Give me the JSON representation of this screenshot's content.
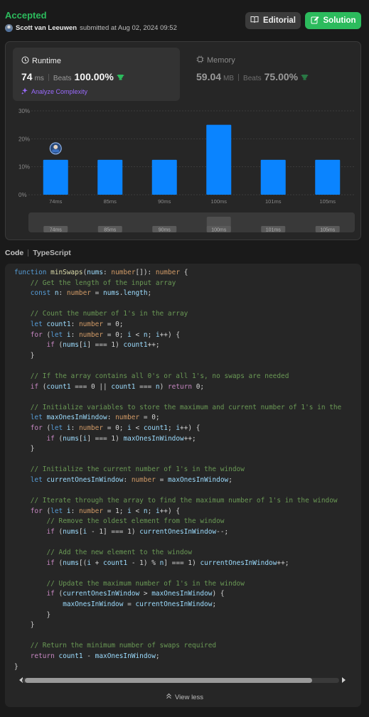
{
  "header": {
    "status": "Accepted",
    "username": "Scott van Leeuwen",
    "submitted_text": "submitted at Aug 02, 2024 09:52",
    "editorial_label": "Editorial",
    "solution_label": "Solution"
  },
  "runtime": {
    "title": "Runtime",
    "value": "74",
    "unit": "ms",
    "beats_label": "Beats",
    "beats_value": "100.00%",
    "analyze_label": "Analyze Complexity"
  },
  "memory": {
    "title": "Memory",
    "value": "59.04",
    "unit": "MB",
    "beats_label": "Beats",
    "beats_value": "75.00%"
  },
  "chart_data": {
    "type": "bar",
    "categories": [
      "74ms",
      "85ms",
      "90ms",
      "100ms",
      "101ms",
      "105ms"
    ],
    "values": [
      12.5,
      12.5,
      12.5,
      25,
      12.5,
      12.5
    ],
    "y_ticks": [
      "30%",
      "20%",
      "10%",
      "0%"
    ],
    "ylim": [
      0,
      30
    ],
    "highlight_index": 0,
    "bar_color": "#0a84ff",
    "grid": true
  },
  "scrubber": {
    "labels": [
      "74ms",
      "85ms",
      "90ms",
      "100ms",
      "101ms",
      "105ms"
    ],
    "selected_index": 3
  },
  "code_section": {
    "label": "Code",
    "language": "TypeScript",
    "lines": [
      [
        [
          "kw",
          "function "
        ],
        [
          "fn",
          "minSwaps"
        ],
        [
          "nm",
          "("
        ],
        [
          "va",
          "nums"
        ],
        [
          "nm",
          ": "
        ],
        [
          "ty",
          "number"
        ],
        [
          "nm",
          "[]): "
        ],
        [
          "ty",
          "number"
        ],
        [
          "nm",
          " {"
        ]
      ],
      [
        [
          "nm",
          "    "
        ],
        [
          "cm",
          "// Get the length of the input array"
        ]
      ],
      [
        [
          "nm",
          "    "
        ],
        [
          "kw",
          "const "
        ],
        [
          "va",
          "n"
        ],
        [
          "nm",
          ": "
        ],
        [
          "ty",
          "number"
        ],
        [
          "nm",
          " = "
        ],
        [
          "va",
          "nums"
        ],
        [
          "nm",
          "."
        ],
        [
          "va",
          "length"
        ],
        [
          "nm",
          ";"
        ]
      ],
      [
        [
          "nm",
          ""
        ]
      ],
      [
        [
          "nm",
          "    "
        ],
        [
          "cm",
          "// Count the number of 1's in the array"
        ]
      ],
      [
        [
          "nm",
          "    "
        ],
        [
          "kw",
          "let "
        ],
        [
          "va",
          "count1"
        ],
        [
          "nm",
          ": "
        ],
        [
          "ty",
          "number"
        ],
        [
          "nm",
          " = 0;"
        ]
      ],
      [
        [
          "nm",
          "    "
        ],
        [
          "kw2",
          "for "
        ],
        [
          "nm",
          "("
        ],
        [
          "kw",
          "let "
        ],
        [
          "va",
          "i"
        ],
        [
          "nm",
          ": "
        ],
        [
          "ty",
          "number"
        ],
        [
          "nm",
          " = 0; "
        ],
        [
          "va",
          "i"
        ],
        [
          "nm",
          " < "
        ],
        [
          "va",
          "n"
        ],
        [
          "nm",
          "; "
        ],
        [
          "va",
          "i"
        ],
        [
          "nm",
          "++) {"
        ]
      ],
      [
        [
          "nm",
          "        "
        ],
        [
          "kw2",
          "if "
        ],
        [
          "nm",
          "("
        ],
        [
          "va",
          "nums"
        ],
        [
          "nm",
          "["
        ],
        [
          "va",
          "i"
        ],
        [
          "nm",
          "] === 1) "
        ],
        [
          "va",
          "count1"
        ],
        [
          "nm",
          "++;"
        ]
      ],
      [
        [
          "nm",
          "    }"
        ]
      ],
      [
        [
          "nm",
          ""
        ]
      ],
      [
        [
          "nm",
          "    "
        ],
        [
          "cm",
          "// If the array contains all 0's or all 1's, no swaps are needed"
        ]
      ],
      [
        [
          "nm",
          "    "
        ],
        [
          "kw2",
          "if "
        ],
        [
          "nm",
          "("
        ],
        [
          "va",
          "count1"
        ],
        [
          "nm",
          " === 0 || "
        ],
        [
          "va",
          "count1"
        ],
        [
          "nm",
          " === "
        ],
        [
          "va",
          "n"
        ],
        [
          "nm",
          ") "
        ],
        [
          "kw2",
          "return "
        ],
        [
          "nm",
          "0;"
        ]
      ],
      [
        [
          "nm",
          ""
        ]
      ],
      [
        [
          "nm",
          "    "
        ],
        [
          "cm",
          "// Initialize variables to store the maximum and current number of 1's in the"
        ]
      ],
      [
        [
          "nm",
          "    "
        ],
        [
          "kw",
          "let "
        ],
        [
          "va",
          "maxOnesInWindow"
        ],
        [
          "nm",
          ": "
        ],
        [
          "ty",
          "number"
        ],
        [
          "nm",
          " = 0;"
        ]
      ],
      [
        [
          "nm",
          "    "
        ],
        [
          "kw2",
          "for "
        ],
        [
          "nm",
          "("
        ],
        [
          "kw",
          "let "
        ],
        [
          "va",
          "i"
        ],
        [
          "nm",
          ": "
        ],
        [
          "ty",
          "number"
        ],
        [
          "nm",
          " = 0; "
        ],
        [
          "va",
          "i"
        ],
        [
          "nm",
          " < "
        ],
        [
          "va",
          "count1"
        ],
        [
          "nm",
          "; "
        ],
        [
          "va",
          "i"
        ],
        [
          "nm",
          "++) {"
        ]
      ],
      [
        [
          "nm",
          "        "
        ],
        [
          "kw2",
          "if "
        ],
        [
          "nm",
          "("
        ],
        [
          "va",
          "nums"
        ],
        [
          "nm",
          "["
        ],
        [
          "va",
          "i"
        ],
        [
          "nm",
          "] === 1) "
        ],
        [
          "va",
          "maxOnesInWindow"
        ],
        [
          "nm",
          "++;"
        ]
      ],
      [
        [
          "nm",
          "    }"
        ]
      ],
      [
        [
          "nm",
          ""
        ]
      ],
      [
        [
          "nm",
          "    "
        ],
        [
          "cm",
          "// Initialize the current number of 1's in the window"
        ]
      ],
      [
        [
          "nm",
          "    "
        ],
        [
          "kw",
          "let "
        ],
        [
          "va",
          "currentOnesInWindow"
        ],
        [
          "nm",
          ": "
        ],
        [
          "ty",
          "number"
        ],
        [
          "nm",
          " = "
        ],
        [
          "va",
          "maxOnesInWindow"
        ],
        [
          "nm",
          ";"
        ]
      ],
      [
        [
          "nm",
          ""
        ]
      ],
      [
        [
          "nm",
          "    "
        ],
        [
          "cm",
          "// Iterate through the array to find the maximum number of 1's in the window"
        ]
      ],
      [
        [
          "nm",
          "    "
        ],
        [
          "kw2",
          "for "
        ],
        [
          "nm",
          "("
        ],
        [
          "kw",
          "let "
        ],
        [
          "va",
          "i"
        ],
        [
          "nm",
          ": "
        ],
        [
          "ty",
          "number"
        ],
        [
          "nm",
          " = 1; "
        ],
        [
          "va",
          "i"
        ],
        [
          "nm",
          " < "
        ],
        [
          "va",
          "n"
        ],
        [
          "nm",
          "; "
        ],
        [
          "va",
          "i"
        ],
        [
          "nm",
          "++) {"
        ]
      ],
      [
        [
          "nm",
          "        "
        ],
        [
          "cm",
          "// Remove the oldest element from the window"
        ]
      ],
      [
        [
          "nm",
          "        "
        ],
        [
          "kw2",
          "if "
        ],
        [
          "nm",
          "("
        ],
        [
          "va",
          "nums"
        ],
        [
          "nm",
          "["
        ],
        [
          "va",
          "i"
        ],
        [
          "nm",
          " - 1] === 1) "
        ],
        [
          "va",
          "currentOnesInWindow"
        ],
        [
          "nm",
          "--;"
        ]
      ],
      [
        [
          "nm",
          ""
        ]
      ],
      [
        [
          "nm",
          "        "
        ],
        [
          "cm",
          "// Add the new element to the window"
        ]
      ],
      [
        [
          "nm",
          "        "
        ],
        [
          "kw2",
          "if "
        ],
        [
          "nm",
          "("
        ],
        [
          "va",
          "nums"
        ],
        [
          "nm",
          "[("
        ],
        [
          "va",
          "i"
        ],
        [
          "nm",
          " + "
        ],
        [
          "va",
          "count1"
        ],
        [
          "nm",
          " - 1) % "
        ],
        [
          "va",
          "n"
        ],
        [
          "nm",
          "] === 1) "
        ],
        [
          "va",
          "currentOnesInWindow"
        ],
        [
          "nm",
          "++;"
        ]
      ],
      [
        [
          "nm",
          ""
        ]
      ],
      [
        [
          "nm",
          "        "
        ],
        [
          "cm",
          "// Update the maximum number of 1's in the window"
        ]
      ],
      [
        [
          "nm",
          "        "
        ],
        [
          "kw2",
          "if "
        ],
        [
          "nm",
          "("
        ],
        [
          "va",
          "currentOnesInWindow"
        ],
        [
          "nm",
          " > "
        ],
        [
          "va",
          "maxOnesInWindow"
        ],
        [
          "nm",
          ") {"
        ]
      ],
      [
        [
          "nm",
          "            "
        ],
        [
          "va",
          "maxOnesInWindow"
        ],
        [
          "nm",
          " = "
        ],
        [
          "va",
          "currentOnesInWindow"
        ],
        [
          "nm",
          ";"
        ]
      ],
      [
        [
          "nm",
          "        }"
        ]
      ],
      [
        [
          "nm",
          "    }"
        ]
      ],
      [
        [
          "nm",
          ""
        ]
      ],
      [
        [
          "nm",
          "    "
        ],
        [
          "cm",
          "// Return the minimum number of swaps required"
        ]
      ],
      [
        [
          "nm",
          "    "
        ],
        [
          "kw2",
          "return "
        ],
        [
          "va",
          "count1"
        ],
        [
          "nm",
          " - "
        ],
        [
          "va",
          "maxOnesInWindow"
        ],
        [
          "nm",
          ";"
        ]
      ],
      [
        [
          "nm",
          "}"
        ]
      ]
    ]
  },
  "footer": {
    "view_less_label": "View less"
  },
  "colors": {
    "accepted": "#2cbb5d",
    "bar": "#0a84ff",
    "beats_icon": "#2cbb5d",
    "analyze": "#9b6bff"
  }
}
